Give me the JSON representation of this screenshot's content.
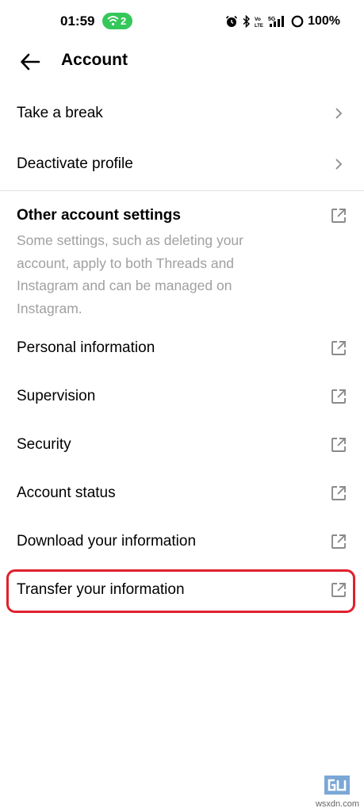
{
  "status_bar": {
    "time": "01:59",
    "hotspot_count": "2",
    "battery": "100%",
    "network_label": "5G"
  },
  "header": {
    "title": "Account"
  },
  "rows_top": [
    {
      "label": "Take a break"
    },
    {
      "label": "Deactivate profile"
    }
  ],
  "other_settings": {
    "title": "Other account settings",
    "description": "Some settings, such as deleting your account, apply to both Threads and Instagram and can be managed on Instagram."
  },
  "rows_external": [
    {
      "label": "Personal information"
    },
    {
      "label": "Supervision"
    },
    {
      "label": "Security"
    },
    {
      "label": "Account status"
    },
    {
      "label": "Download your information"
    },
    {
      "label": "Transfer your information"
    }
  ],
  "highlight_color": "#e0202e",
  "hotspot_color": "#34c759",
  "watermark": {
    "text": "wsxdn.com"
  }
}
